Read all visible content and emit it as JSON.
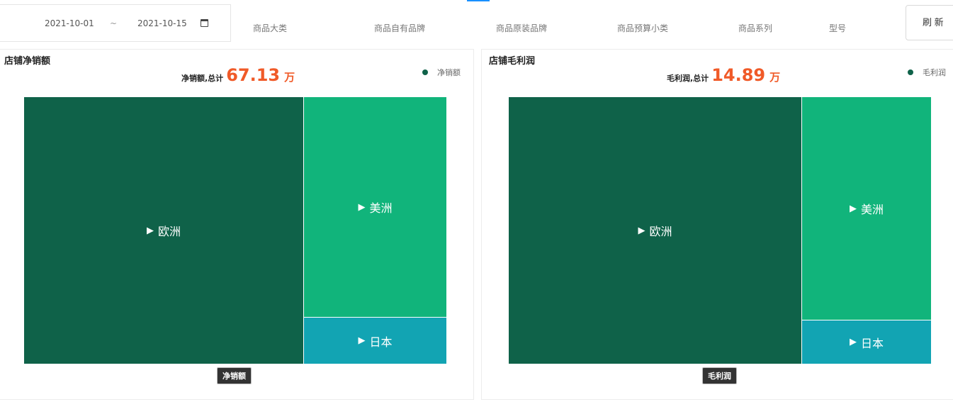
{
  "filters": {
    "date_start": "2021-10-01",
    "date_sep": "~",
    "date_end": "2021-10-15",
    "labels": [
      "商品大类",
      "商品自有品牌",
      "商品原装品牌",
      "商品预算小类",
      "商品系列",
      "型号"
    ],
    "refresh_label": "刷 新"
  },
  "colors": {
    "europe": "#0f6249",
    "americas": "#11b47b",
    "japan": "#12a4b3",
    "total_accent": "#f05a28"
  },
  "panels": [
    {
      "title": "店铺净销额",
      "total_label": "净销额,总计",
      "total_value": "67.13",
      "total_unit": "万",
      "legend": "净销额",
      "tag": "净销额"
    },
    {
      "title": "店铺毛利润",
      "total_label": "毛利润,总计",
      "total_value": "14.89",
      "total_unit": "万",
      "legend": "毛利润",
      "tag": "毛利润"
    }
  ],
  "chart_data": [
    {
      "type": "treemap",
      "title": "店铺净销额",
      "series_name": "净销额",
      "total": 67.13,
      "unit": "万",
      "nodes": [
        {
          "name": "欧洲",
          "value": 44.4
        },
        {
          "name": "美洲",
          "value": 18.7
        },
        {
          "name": "日本",
          "value": 4.0
        }
      ]
    },
    {
      "type": "treemap",
      "title": "店铺毛利润",
      "series_name": "毛利润",
      "total": 14.89,
      "unit": "万",
      "nodes": [
        {
          "name": "欧洲",
          "value": 10.32
        },
        {
          "name": "美洲",
          "value": 3.82
        },
        {
          "name": "日本",
          "value": 0.75
        }
      ]
    }
  ]
}
